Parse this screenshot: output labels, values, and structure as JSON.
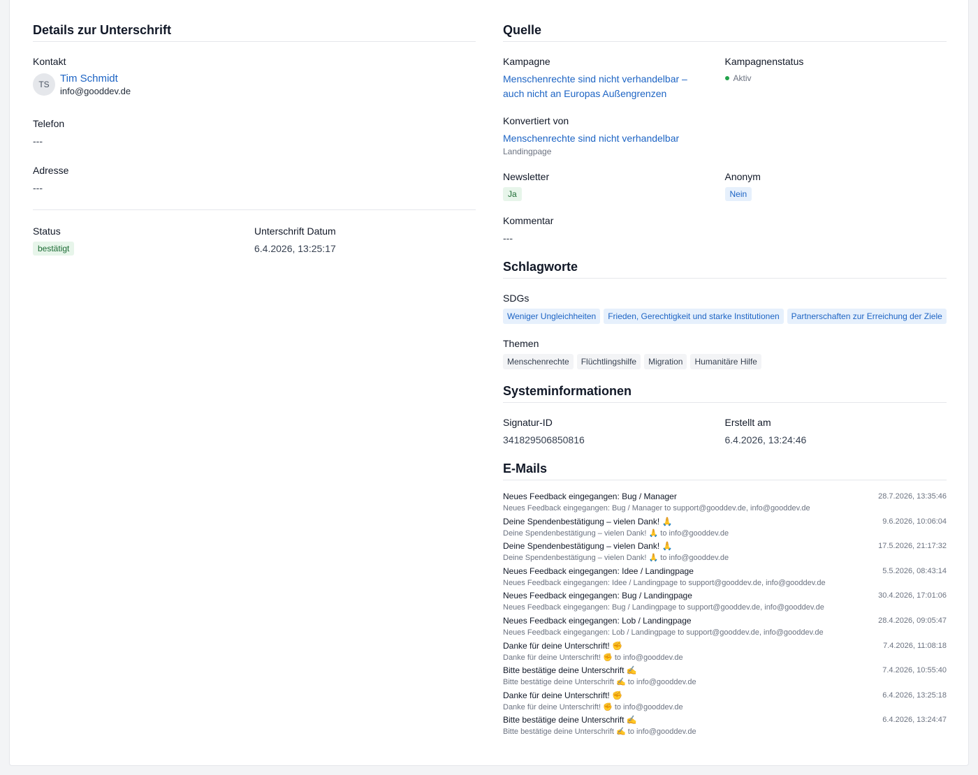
{
  "signature_details": {
    "title": "Details zur Unterschrift",
    "contact_label": "Kontakt",
    "contact": {
      "initials": "TS",
      "name": "Tim Schmidt",
      "email": "info@gooddev.de"
    },
    "phone_label": "Telefon",
    "phone_value": "---",
    "address_label": "Adresse",
    "address_value": "---",
    "status_label": "Status",
    "status_value": "bestätigt",
    "date_label": "Unterschrift Datum",
    "date_value": "6.4.2026, 13:25:17"
  },
  "source": {
    "title": "Quelle",
    "campaign_label": "Kampagne",
    "campaign_value": "Menschenrechte sind nicht verhandelbar – auch nicht an Europas Außengrenzen",
    "campaign_status_label": "Kampagnenstatus",
    "campaign_status_value": "Aktiv",
    "converted_label": "Konvertiert von",
    "converted_value": "Menschenrechte sind nicht verhandelbar",
    "converted_type": "Landingpage",
    "newsletter_label": "Newsletter",
    "newsletter_value": "Ja",
    "anonymous_label": "Anonym",
    "anonymous_value": "Nein",
    "comment_label": "Kommentar",
    "comment_value": "---"
  },
  "keywords": {
    "title": "Schlagworte",
    "sdgs_label": "SDGs",
    "sdgs": [
      "Weniger Ungleichheiten",
      "Frieden, Gerechtigkeit und starke Institutionen",
      "Partnerschaften zur Erreichung der Ziele"
    ],
    "topics_label": "Themen",
    "topics": [
      "Menschenrechte",
      "Flüchtlingshilfe",
      "Migration",
      "Humanitäre Hilfe"
    ]
  },
  "system": {
    "title": "Systeminformationen",
    "signature_id_label": "Signatur-ID",
    "signature_id_value": "341829506850816",
    "created_label": "Erstellt am",
    "created_value": "6.4.2026, 13:24:46"
  },
  "emails": {
    "title": "E-Mails",
    "items": [
      {
        "subject": "Neues Feedback eingegangen: Bug / Manager",
        "date": "28.7.2026, 13:35:46",
        "meta": "Neues Feedback eingegangen: Bug / Manager to support@gooddev.de, info@gooddev.de"
      },
      {
        "subject": "Deine Spendenbestätigung – vielen Dank! 🙏",
        "date": "9.6.2026, 10:06:04",
        "meta": "Deine Spendenbestätigung – vielen Dank! 🙏 to info@gooddev.de"
      },
      {
        "subject": "Deine Spendenbestätigung – vielen Dank! 🙏",
        "date": "17.5.2026, 21:17:32",
        "meta": "Deine Spendenbestätigung – vielen Dank! 🙏 to info@gooddev.de"
      },
      {
        "subject": "Neues Feedback eingegangen: Idee / Landingpage",
        "date": "5.5.2026, 08:43:14",
        "meta": "Neues Feedback eingegangen: Idee / Landingpage to support@gooddev.de, info@gooddev.de"
      },
      {
        "subject": "Neues Feedback eingegangen: Bug / Landingpage",
        "date": "30.4.2026, 17:01:06",
        "meta": "Neues Feedback eingegangen: Bug / Landingpage to support@gooddev.de, info@gooddev.de"
      },
      {
        "subject": "Neues Feedback eingegangen: Lob / Landingpage",
        "date": "28.4.2026, 09:05:47",
        "meta": "Neues Feedback eingegangen: Lob / Landingpage to support@gooddev.de, info@gooddev.de"
      },
      {
        "subject": "Danke für deine Unterschrift! ✊",
        "date": "7.4.2026, 11:08:18",
        "meta": "Danke für deine Unterschrift! ✊ to info@gooddev.de"
      },
      {
        "subject": "Bitte bestätige deine Unterschrift ✍️",
        "date": "7.4.2026, 10:55:40",
        "meta": "Bitte bestätige deine Unterschrift ✍️ to info@gooddev.de"
      },
      {
        "subject": "Danke für deine Unterschrift! ✊",
        "date": "6.4.2026, 13:25:18",
        "meta": "Danke für deine Unterschrift! ✊ to info@gooddev.de"
      },
      {
        "subject": "Bitte bestätige deine Unterschrift ✍️",
        "date": "6.4.2026, 13:24:47",
        "meta": "Bitte bestätige deine Unterschrift ✍️ to info@gooddev.de"
      }
    ]
  },
  "colors": {
    "link": "#1d64c4",
    "success": "#1c6b34",
    "success_bg": "#e7f5ea",
    "info_bg": "#e6f0fc",
    "active_dot": "#22a34a"
  }
}
